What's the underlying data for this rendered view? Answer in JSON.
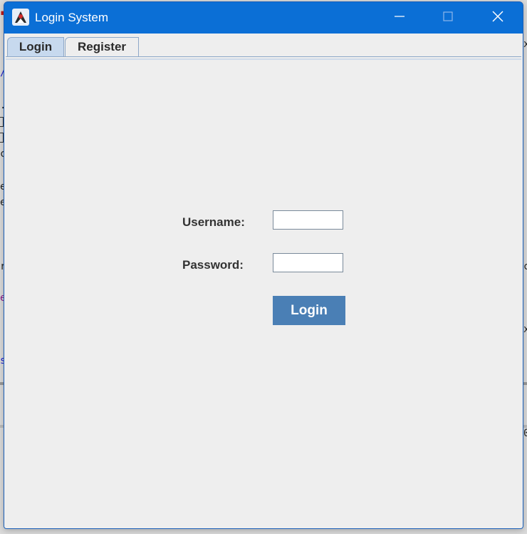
{
  "window": {
    "title": "Login System",
    "icon": "java-duke-icon",
    "controls": {
      "minimize_icon": "minimize-icon",
      "maximize_icon": "maximize-icon",
      "close_icon": "close-icon"
    }
  },
  "tabs": [
    {
      "label": "Login",
      "active": true
    },
    {
      "label": "Register",
      "active": false
    }
  ],
  "form": {
    "username_label": "Username:",
    "username_value": "",
    "password_label": "Password:",
    "password_value": "",
    "login_button_label": "Login"
  },
  "colors": {
    "titlebar": "#0b6fd6",
    "active_tab": "#c7d9ee",
    "button": "#4a7fb5",
    "panel": "#eeeeee"
  }
}
